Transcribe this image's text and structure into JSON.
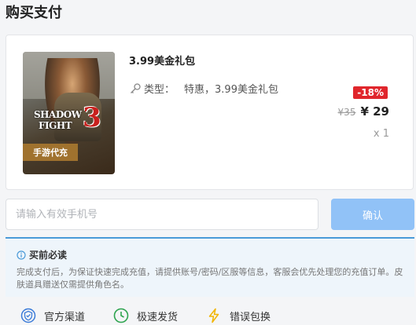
{
  "page": {
    "title": "购买支付"
  },
  "product": {
    "name": "3.99美金礼包",
    "type_label": "类型：",
    "type_value": "特惠，3.99美金礼包",
    "discount": "-18%",
    "old_price": "¥35",
    "new_price": "¥ 29",
    "quantity": "x 1",
    "image": {
      "logo_line1": "SHADOW",
      "logo_line2": "FIGHT",
      "logo_number": "3",
      "tag": "手游代充"
    }
  },
  "form": {
    "phone_placeholder": "请输入有效手机号",
    "confirm_label": "确认"
  },
  "notice": {
    "title": "买前必读",
    "text": "完成支付后，为保证快速完成充值，请提供账号/密码/区服等信息，客服会优先处理您的充值订单。皮肤道具赠送仅需提供角色名。"
  },
  "features": [
    {
      "label": "官方渠道",
      "icon": "shield-badge-icon"
    },
    {
      "label": "极速发货",
      "icon": "clock-icon"
    },
    {
      "label": "错误包换",
      "icon": "lightning-icon"
    }
  ],
  "colors": {
    "accent_blue": "#91c2f7",
    "discount_red": "#e0262c",
    "notice_bg": "#eef5fb",
    "notice_border": "#4a9ad8",
    "clock_green": "#2ea44f",
    "lightning_yellow": "#f2b500",
    "shield_blue": "#3b7bd8"
  }
}
